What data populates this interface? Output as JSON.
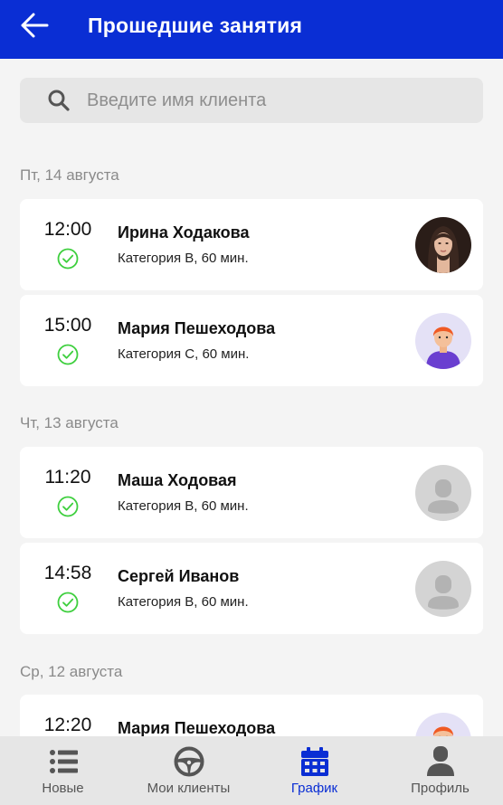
{
  "header": {
    "title": "Прошедшие занятия",
    "back_icon": "arrow-left-icon"
  },
  "search": {
    "placeholder": "Введите имя клиента",
    "value": "",
    "icon": "search-icon"
  },
  "days": [
    {
      "label": "Пт, 14 августа",
      "lessons": [
        {
          "time": "12:00",
          "name": "Ирина Ходакова",
          "details": "Категория B, 60 мин.",
          "avatar": "photo",
          "status": "completed"
        },
        {
          "time": "15:00",
          "name": "Мария Пешеходова",
          "details": "Категория C, 60 мин.",
          "avatar": "cartoon",
          "status": "completed"
        }
      ]
    },
    {
      "label": "Чт, 13 августа",
      "lessons": [
        {
          "time": "11:20",
          "name": "Маша Ходовая",
          "details": "Категория B, 60 мин.",
          "avatar": "placeholder",
          "status": "completed"
        },
        {
          "time": "14:58",
          "name": "Сергей Иванов",
          "details": "Категория B, 60 мин.",
          "avatar": "placeholder",
          "status": "completed"
        }
      ]
    },
    {
      "label": "Ср, 12 августа",
      "lessons": [
        {
          "time": "12:20",
          "name": "Мария Пешеходова",
          "details": "",
          "avatar": "cartoon",
          "status": "completed"
        }
      ]
    }
  ],
  "bottom_nav": {
    "items": [
      {
        "label": "Новые",
        "icon": "list-icon",
        "active": false
      },
      {
        "label": "Мои клиенты",
        "icon": "steering-wheel-icon",
        "active": false
      },
      {
        "label": "График",
        "icon": "calendar-icon",
        "active": true
      },
      {
        "label": "Профиль",
        "icon": "person-icon",
        "active": false
      }
    ]
  },
  "colors": {
    "header_bg": "#0a2ed4",
    "active_nav": "#0a2ed4",
    "inactive_nav": "#555555",
    "check": "#3ecf3e",
    "background": "#f4f4f4"
  }
}
